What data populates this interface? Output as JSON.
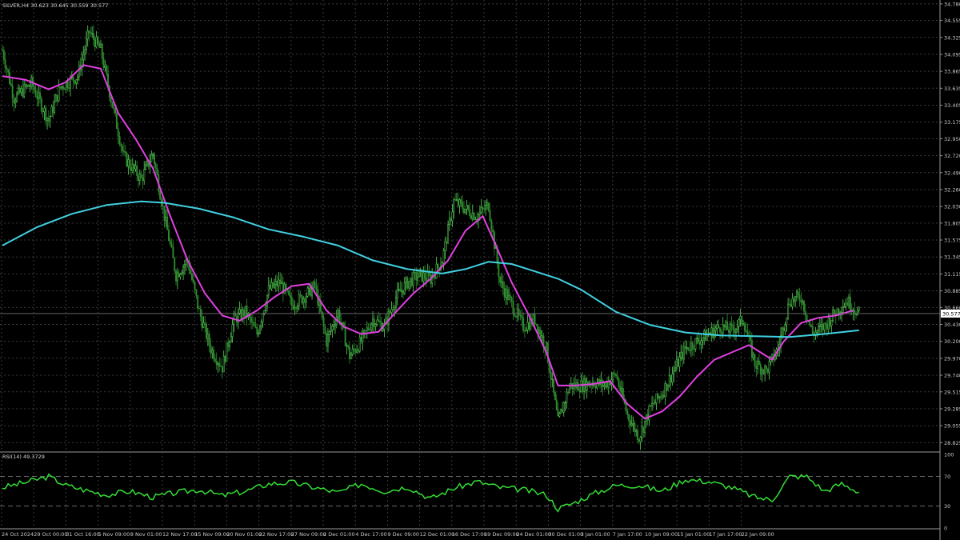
{
  "header": {
    "symbol_line": "SILVER,H4  30.623 30.645 30.559 30.577"
  },
  "colors": {
    "background": "#000000",
    "grid": "#3a3a3a",
    "bull_candle": "#5bd35b",
    "bear_candle": "#2e8b2e",
    "ma_fast": "#e040e0",
    "ma_slow": "#40d0e0",
    "rsi_line": "#33dd33",
    "axis_text": "#c8c8c8"
  },
  "chart_data": [
    {
      "type": "candlestick",
      "title": "SILVER,H4",
      "ohlc_last": {
        "open": 30.623,
        "high": 30.645,
        "low": 30.559,
        "close": 30.577
      },
      "current_price_label": "30.577",
      "y_ticks": [
        "34.780",
        "34.555",
        "34.325",
        "34.095",
        "33.865",
        "33.635",
        "33.405",
        "33.175",
        "32.950",
        "32.720",
        "32.490",
        "32.260",
        "32.030",
        "31.805",
        "31.575",
        "31.345",
        "31.115",
        "30.885",
        "30.660",
        "30.430",
        "30.200",
        "29.970",
        "29.740",
        "29.515",
        "29.285",
        "29.055",
        "28.825"
      ],
      "ylim": [
        28.72,
        34.8
      ],
      "x_ticks": [
        "24 Oct 2024",
        "29 Oct 00:00",
        "31 Oct 16:00",
        "5 Nov 09:00",
        "8 Nov 01:00",
        "12 Nov 17:00",
        "15 Nov 09:00",
        "20 Nov 01:00",
        "22 Nov 17:00",
        "27 Nov 09:00",
        "2 Dec 01:00",
        "4 Dec 17:00",
        "9 Dec 09:00",
        "12 Dec 01:00",
        "16 Dec 17:00",
        "19 Dec 09:00",
        "24 Dec 01:00",
        "30 Dec 01:00",
        "3 Jan 01:00",
        "7 Jan 17:00",
        "10 Jan 09:00",
        "15 Jan 01:00",
        "17 Jan 17:00",
        "22 Jan 09:00"
      ],
      "price_path": [
        [
          0,
          34.15
        ],
        [
          2,
          33.5
        ],
        [
          5,
          33.7
        ],
        [
          8,
          33.2
        ],
        [
          10,
          33.65
        ],
        [
          13,
          33.8
        ],
        [
          15,
          34.4
        ],
        [
          17,
          34.15
        ],
        [
          19,
          33.4
        ],
        [
          21,
          32.7
        ],
        [
          24,
          32.4
        ],
        [
          26,
          32.75
        ],
        [
          28,
          31.9
        ],
        [
          30,
          31.1
        ],
        [
          32,
          31.3
        ],
        [
          34,
          30.6
        ],
        [
          36,
          30.1
        ],
        [
          38,
          29.85
        ],
        [
          40,
          30.5
        ],
        [
          42,
          30.6
        ],
        [
          44,
          30.3
        ],
        [
          46,
          30.9
        ],
        [
          48,
          31.0
        ],
        [
          50,
          30.7
        ],
        [
          52,
          30.8
        ],
        [
          54,
          30.95
        ],
        [
          56,
          30.2
        ],
        [
          58,
          30.6
        ],
        [
          60,
          30.0
        ],
        [
          62,
          30.2
        ],
        [
          64,
          30.5
        ],
        [
          66,
          30.4
        ],
        [
          68,
          30.8
        ],
        [
          70,
          31.0
        ],
        [
          72,
          31.1
        ],
        [
          74,
          31.05
        ],
        [
          76,
          31.3
        ],
        [
          78,
          32.1
        ],
        [
          80,
          32.0
        ],
        [
          82,
          31.9
        ],
        [
          84,
          32.05
        ],
        [
          86,
          31.0
        ],
        [
          88,
          30.7
        ],
        [
          90,
          30.4
        ],
        [
          92,
          30.5
        ],
        [
          94,
          30.1
        ],
        [
          96,
          29.1
        ],
        [
          98,
          29.6
        ],
        [
          100,
          29.6
        ],
        [
          102,
          29.65
        ],
        [
          104,
          29.6
        ],
        [
          106,
          29.75
        ],
        [
          108,
          29.2
        ],
        [
          110,
          28.9
        ],
        [
          112,
          29.3
        ],
        [
          114,
          29.5
        ],
        [
          116,
          29.8
        ],
        [
          118,
          30.1
        ],
        [
          120,
          30.2
        ],
        [
          122,
          30.3
        ],
        [
          124,
          30.4
        ],
        [
          126,
          30.35
        ],
        [
          128,
          30.5
        ],
        [
          130,
          29.9
        ],
        [
          132,
          29.8
        ],
        [
          134,
          30.1
        ],
        [
          136,
          30.75
        ],
        [
          138,
          30.8
        ],
        [
          140,
          30.3
        ],
        [
          142,
          30.4
        ],
        [
          144,
          30.6
        ],
        [
          146,
          30.75
        ],
        [
          148,
          30.58
        ]
      ],
      "series": [
        {
          "name": "",
          "color": "#e040e0",
          "values": [
            [
              0,
              33.8
            ],
            [
              4,
              33.75
            ],
            [
              8,
              33.62
            ],
            [
              11,
              33.72
            ],
            [
              14,
              33.95
            ],
            [
              17,
              33.9
            ],
            [
              20,
              33.3
            ],
            [
              23,
              32.95
            ],
            [
              26,
              32.55
            ],
            [
              29,
              31.9
            ],
            [
              32,
              31.3
            ],
            [
              35,
              30.85
            ],
            [
              38,
              30.55
            ],
            [
              41,
              30.48
            ],
            [
              44,
              30.62
            ],
            [
              47,
              30.8
            ],
            [
              50,
              30.95
            ],
            [
              53,
              30.98
            ],
            [
              56,
              30.62
            ],
            [
              59,
              30.4
            ],
            [
              62,
              30.3
            ],
            [
              65,
              30.33
            ],
            [
              68,
              30.6
            ],
            [
              71,
              30.85
            ],
            [
              74,
              31.05
            ],
            [
              77,
              31.3
            ],
            [
              80,
              31.7
            ],
            [
              83,
              31.9
            ],
            [
              85,
              31.55
            ],
            [
              88,
              31.0
            ],
            [
              91,
              30.55
            ],
            [
              94,
              30.05
            ],
            [
              96,
              29.6
            ],
            [
              99,
              29.6
            ],
            [
              102,
              29.62
            ],
            [
              105,
              29.66
            ],
            [
              108,
              29.35
            ],
            [
              111,
              29.15
            ],
            [
              114,
              29.25
            ],
            [
              117,
              29.45
            ],
            [
              120,
              29.72
            ],
            [
              123,
              29.95
            ],
            [
              126,
              30.05
            ],
            [
              129,
              30.15
            ],
            [
              131,
              30.05
            ],
            [
              133,
              29.95
            ],
            [
              135,
              30.2
            ],
            [
              138,
              30.45
            ],
            [
              141,
              30.52
            ],
            [
              144,
              30.55
            ],
            [
              147,
              30.62
            ]
          ]
        },
        {
          "name": "",
          "color": "#40d0e0",
          "values": [
            [
              0,
              31.5
            ],
            [
              6,
              31.75
            ],
            [
              12,
              31.93
            ],
            [
              18,
              32.05
            ],
            [
              24,
              32.1
            ],
            [
              28,
              32.08
            ],
            [
              34,
              32.0
            ],
            [
              40,
              31.88
            ],
            [
              46,
              31.72
            ],
            [
              52,
              31.62
            ],
            [
              58,
              31.5
            ],
            [
              64,
              31.3
            ],
            [
              70,
              31.18
            ],
            [
              76,
              31.12
            ],
            [
              80,
              31.18
            ],
            [
              84,
              31.28
            ],
            [
              88,
              31.25
            ],
            [
              92,
              31.15
            ],
            [
              96,
              31.05
            ],
            [
              100,
              30.9
            ],
            [
              106,
              30.6
            ],
            [
              112,
              30.42
            ],
            [
              118,
              30.32
            ],
            [
              124,
              30.28
            ],
            [
              130,
              30.27
            ],
            [
              136,
              30.26
            ],
            [
              142,
              30.3
            ],
            [
              148,
              30.35
            ]
          ]
        }
      ]
    },
    {
      "type": "line",
      "title": "RSI(14) 49.3729",
      "y_ticks": [
        "100",
        "70",
        "30",
        "0"
      ],
      "ylim": [
        0,
        100
      ],
      "levels": [
        70,
        30
      ],
      "series": [
        {
          "name": "RSI(14)",
          "values": [
            [
              0,
              55
            ],
            [
              4,
              62
            ],
            [
              8,
              70
            ],
            [
              11,
              58
            ],
            [
              14,
              52
            ],
            [
              18,
              45
            ],
            [
              22,
              50
            ],
            [
              26,
              42
            ],
            [
              30,
              48
            ],
            [
              34,
              52
            ],
            [
              38,
              44
            ],
            [
              42,
              50
            ],
            [
              46,
              60
            ],
            [
              50,
              62
            ],
            [
              54,
              55
            ],
            [
              58,
              48
            ],
            [
              62,
              60
            ],
            [
              66,
              50
            ],
            [
              70,
              56
            ],
            [
              74,
              40
            ],
            [
              78,
              54
            ],
            [
              82,
              63
            ],
            [
              86,
              55
            ],
            [
              90,
              52
            ],
            [
              94,
              45
            ],
            [
              96,
              26
            ],
            [
              99,
              35
            ],
            [
              102,
              46
            ],
            [
              106,
              58
            ],
            [
              110,
              58
            ],
            [
              114,
              50
            ],
            [
              118,
              66
            ],
            [
              122,
              63
            ],
            [
              126,
              55
            ],
            [
              130,
              42
            ],
            [
              133,
              38
            ],
            [
              136,
              70
            ],
            [
              139,
              70
            ],
            [
              142,
              50
            ],
            [
              145,
              60
            ],
            [
              148,
              49
            ]
          ]
        }
      ]
    }
  ]
}
